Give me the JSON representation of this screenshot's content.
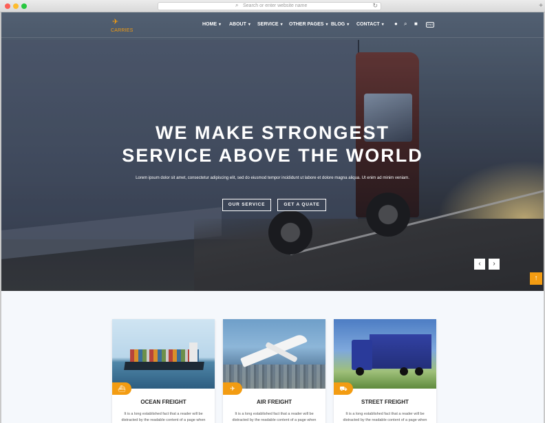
{
  "browser": {
    "address_placeholder": "Search or enter website name",
    "new_tab_symbol": "+"
  },
  "brand": {
    "logo_icon": "plane-icon",
    "name": "CARRIES",
    "accent_color": "#f39c12"
  },
  "nav": {
    "items": [
      {
        "label": "HOME"
      },
      {
        "label": "ABOUT"
      },
      {
        "label": "SERVICE"
      },
      {
        "label": "OTHER PAGES"
      },
      {
        "label": "BLOG"
      },
      {
        "label": "CONTACT"
      }
    ],
    "icons": [
      "user-icon",
      "search-icon",
      "cart-icon"
    ],
    "language": "ENG"
  },
  "hero": {
    "headline_line1": "WE MAKE STRONGEST",
    "headline_line2": "SERVICE ABOVE THE WORLD",
    "lead": "Lorem ipsum dolor sit amet, consectetur adipiscing elit, sed do eiusmod tempor incididunt ut labore et dolore magna aliqua. Ut enim ad minim veniam.",
    "primary_button": "OUR SERVICE",
    "secondary_button": "GET A QUATE",
    "prev_symbol": "‹",
    "next_symbol": "›"
  },
  "scroll_top_symbol": "↑",
  "services": [
    {
      "title": "OCEAN FREIGHT",
      "icon": "ship-icon",
      "text": "It is a long established fact that a reader will be distracted by the readable content of a page when"
    },
    {
      "title": "AIR FREIGHT",
      "icon": "plane-icon",
      "text": "It is a long established fact that a reader will be distracted by the readable content of a page when"
    },
    {
      "title": "STREET FREIGHT",
      "icon": "truck-icon",
      "text": "It is a long established fact that a reader will be distracted by the readable content of a page when"
    }
  ]
}
